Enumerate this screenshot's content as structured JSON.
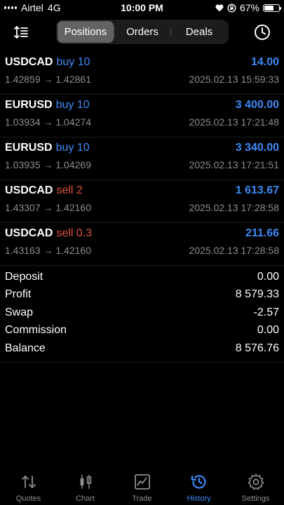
{
  "status_bar": {
    "carrier": "Airtel",
    "network": "4G",
    "time": "10:00 PM",
    "battery": "67%",
    "battery_level": 0.67
  },
  "segments": [
    {
      "label": "Positions",
      "active": true
    },
    {
      "label": "Orders",
      "active": false
    },
    {
      "label": "Deals",
      "active": false
    }
  ],
  "deals": [
    {
      "symbol": "USDCAD",
      "side": "buy 10",
      "side_color": "#3e8af7",
      "profit": "14.00",
      "prices": "1.42859 → 1.42861",
      "time": "2025.02.13 15:59:33"
    },
    {
      "symbol": "EURUSD",
      "side": "buy 10",
      "side_color": "#3e8af7",
      "profit": "3 400.00",
      "prices": "1.03934 → 1.04274",
      "time": "2025.02.13 17:21:48"
    },
    {
      "symbol": "EURUSD",
      "side": "buy 10",
      "side_color": "#3e8af7",
      "profit": "3 340.00",
      "prices": "1.03935 → 1.04269",
      "time": "2025.02.13 17:21:51"
    },
    {
      "symbol": "USDCAD",
      "side": "sell 2",
      "side_color": "#e0533f",
      "profit": "1 613.67",
      "prices": "1.43307 → 1.42160",
      "time": "2025.02.13 17:28:58"
    },
    {
      "symbol": "USDCAD",
      "side": "sell 0.3",
      "side_color": "#e0533f",
      "profit": "211.66",
      "prices": "1.43163 → 1.42160",
      "time": "2025.02.13 17:28:58"
    }
  ],
  "summary": [
    {
      "label": "Deposit",
      "value": "0.00"
    },
    {
      "label": "Profit",
      "value": "8 579.33"
    },
    {
      "label": "Swap",
      "value": "-2.57"
    },
    {
      "label": "Commission",
      "value": "0.00"
    },
    {
      "label": "Balance",
      "value": "8 576.76"
    }
  ],
  "tabs": [
    {
      "label": "Quotes",
      "icon": "quotes-icon",
      "active": false
    },
    {
      "label": "Chart",
      "icon": "chart-icon",
      "active": false
    },
    {
      "label": "Trade",
      "icon": "trade-icon",
      "active": false
    },
    {
      "label": "History",
      "icon": "history-icon",
      "active": true
    },
    {
      "label": "Settings",
      "icon": "gear-icon",
      "active": false
    }
  ],
  "colors": {
    "accent": "#3e8af7",
    "sell": "#e0533f",
    "muted": "#8e8e93"
  }
}
